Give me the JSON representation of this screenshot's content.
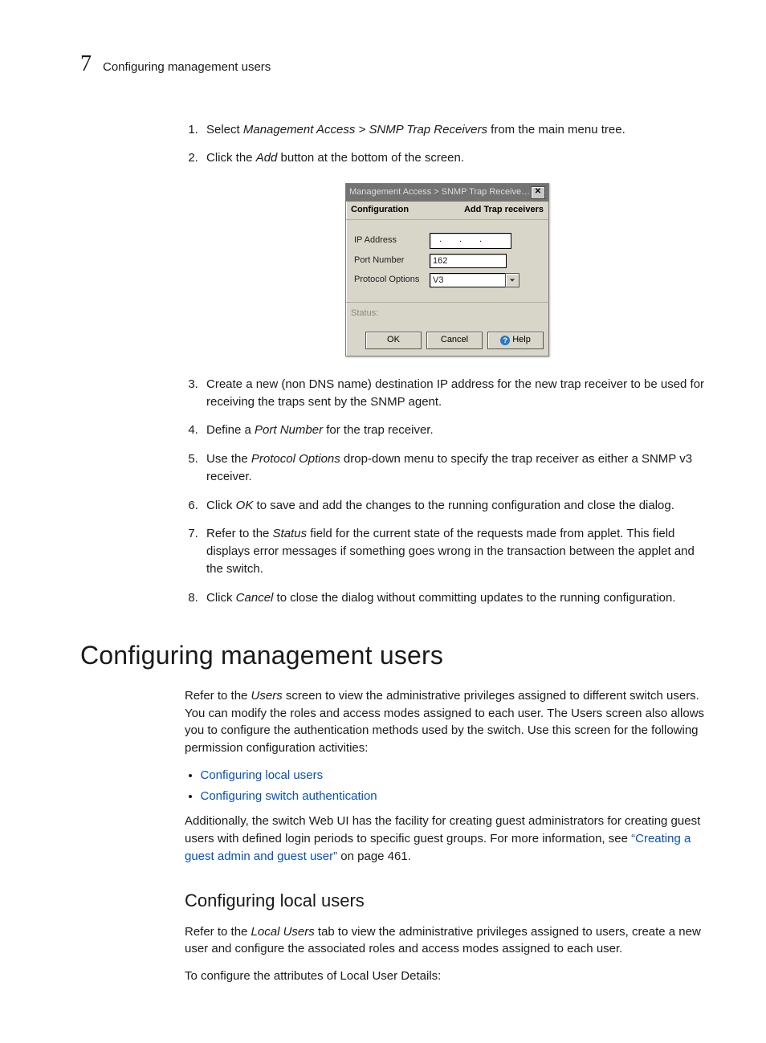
{
  "running_head": {
    "chapter": "7",
    "title": "Configuring management users"
  },
  "steps_a": [
    {
      "prefix": "Select ",
      "em": "Management Access > SNMP Trap Receivers",
      "suffix": " from the main menu tree."
    },
    {
      "prefix": "Click the ",
      "em": "Add",
      "suffix": " button at the bottom of the screen."
    }
  ],
  "dialog": {
    "title": "Management Access > SNMP Trap Receivers ...",
    "sub_left": "Configuration",
    "sub_right": "Add Trap receivers",
    "rows": {
      "ip_label": "IP Address",
      "port_label": "Port Number",
      "port_value": "162",
      "proto_label": "Protocol Options",
      "proto_value": "V3"
    },
    "status_label": "Status:",
    "buttons": {
      "ok": "OK",
      "cancel": "Cancel",
      "help": "Help"
    }
  },
  "steps_b": [
    {
      "text": "Create a new (non DNS name) destination IP address for the new trap receiver to be used for receiving the traps sent by the SNMP agent."
    },
    {
      "prefix": "Define a ",
      "em": "Port Number",
      "suffix": " for the trap receiver."
    },
    {
      "prefix": "Use the ",
      "em": "Protocol Options",
      "suffix": " drop-down menu to specify the trap receiver as either a SNMP v3 receiver."
    },
    {
      "prefix": "Click ",
      "em": "OK",
      "suffix": " to save and add the changes to the running configuration and close the dialog."
    },
    {
      "prefix": "Refer to the ",
      "em": "Status",
      "suffix": " field for the current state of the requests made from applet. This field displays error messages if something goes wrong in the transaction between the applet and the switch."
    },
    {
      "prefix": "Click ",
      "em": "Cancel",
      "suffix": " to close the dialog without committing updates to the running configuration."
    }
  ],
  "section": {
    "heading": "Configuring management users",
    "para1_a": "Refer to the ",
    "para1_em": "Users",
    "para1_b": " screen to view the administrative privileges assigned to different switch users. You can modify the roles and access modes assigned to each user. The Users screen also allows you to configure the authentication methods used by the switch. Use this screen for the following permission configuration activities:",
    "bullets": [
      "Configuring local users",
      "Configuring switch authentication"
    ],
    "para2_a": "Additionally, the switch Web UI has the facility for creating guest administrators for creating guest users with defined login periods to specific guest groups. For more information, see ",
    "para2_link": "“Creating a guest admin and guest user”",
    "para2_b": " on page 461."
  },
  "subsection": {
    "heading": "Configuring local users",
    "p1_a": "Refer to the ",
    "p1_em": "Local Users",
    "p1_b": " tab to view the administrative privileges assigned to users, create a new user and configure the associated roles and access modes assigned to each user.",
    "p2": "To configure the attributes of Local User Details:"
  }
}
